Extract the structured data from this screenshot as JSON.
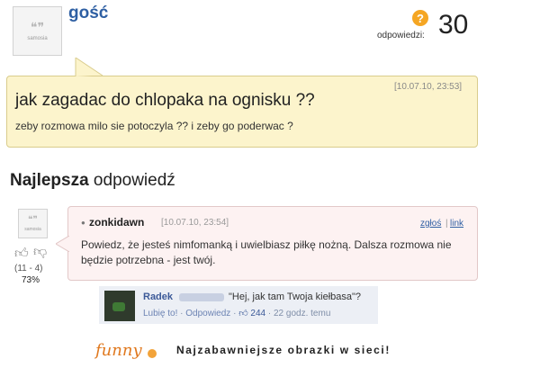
{
  "question": {
    "avatar_label": "samosia",
    "user": "gość",
    "answers_label": "odpowiedzi:",
    "answers_count": "30",
    "answers_icon": "question-mark-icon",
    "date": "[10.07.10, 23:53]",
    "title": "jak zagadac do chlopaka na ognisku ??",
    "description": "zeby rozmowa milo sie potoczyla ?? i zeby go poderwac ?"
  },
  "best_answer": {
    "heading_bold": "Najlepsza",
    "heading_rest": " odpowiedź",
    "avatar_label": "samosia",
    "user": "zonkidawn",
    "date": "[10.07.10, 23:54]",
    "report_label": "zgłoś",
    "separator": "|",
    "link_label": "link",
    "text": "Powiedz, że jesteś nimfomanką i uwielbiasz piłkę nożną. Dalsza rozmowa nie będzie potrzebna - jest twój.",
    "votes": "(11 - 4)",
    "percent": "73%"
  },
  "facebook": {
    "name": "Radek",
    "comment": "\"Hej, jak tam Twoja kiełbasa\"?",
    "like_label": "Lubię to!",
    "dot": " · ",
    "reply_label": "Odpowiedz",
    "like_count": "244",
    "time": "22 godz. temu"
  },
  "footer": {
    "logo_text": "funny",
    "tagline": "Najzabawniejsze obrazki w sieci!"
  },
  "colors": {
    "question_bg": "#fcf4cc",
    "answer_bg": "#fdf2f2",
    "link": "#2e5fa3",
    "facebook_bg": "#eceff5",
    "brand": "#e0781e"
  }
}
